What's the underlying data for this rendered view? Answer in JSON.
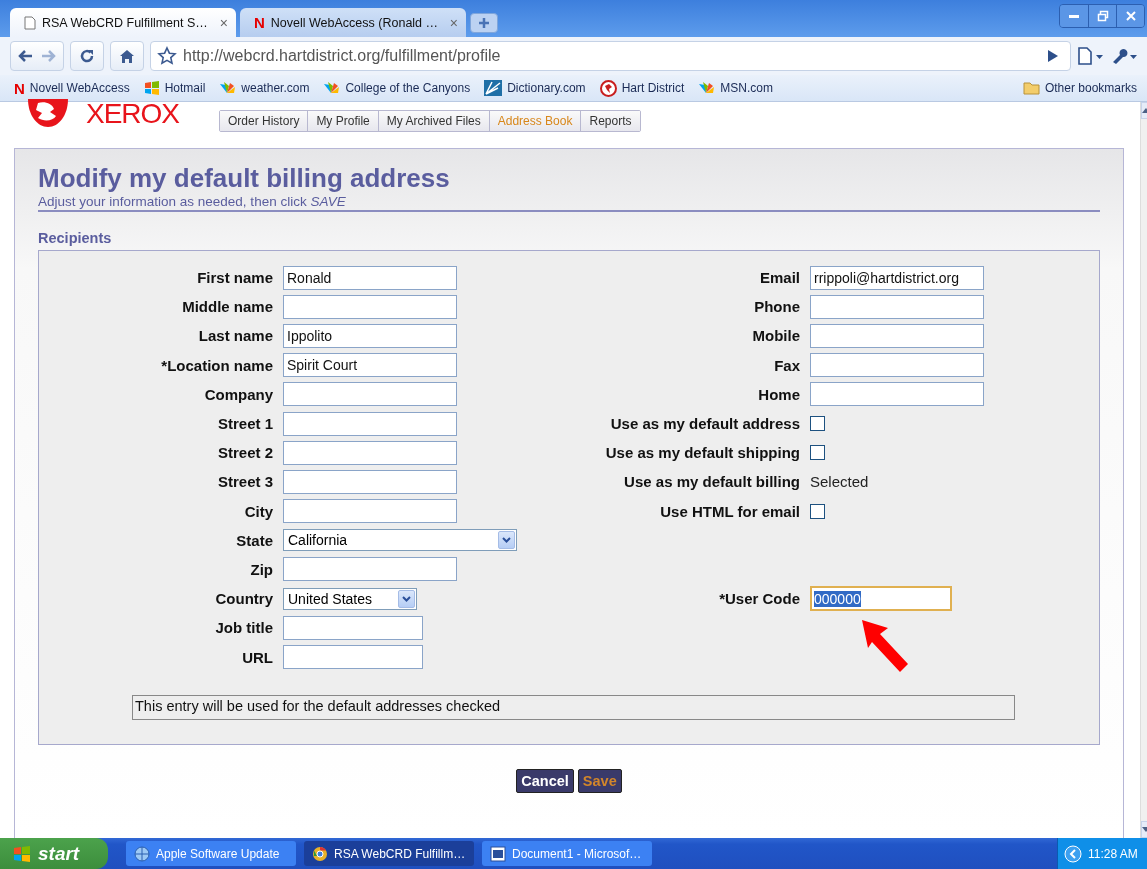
{
  "browser": {
    "tabs": [
      {
        "title": "RSA WebCRD Fulfillment S…",
        "kind": "page",
        "close_mark": "×",
        "selected": true
      },
      {
        "title": "Novell WebAccess (Ronald …",
        "kind": "novell",
        "logo_text": "N",
        "close_mark": "×",
        "selected": false
      }
    ],
    "url": "http://webcrd.hartdistrict.org/fulfillment/profile",
    "bookmarks": [
      {
        "label": "Novell WebAccess",
        "kind": "novell",
        "logo_text": "N"
      },
      {
        "label": "Hotmail",
        "kind": "windows"
      },
      {
        "label": "weather.com",
        "kind": "msn"
      },
      {
        "label": "College of the Canyons",
        "kind": "msn"
      },
      {
        "label": "Dictionary.com",
        "kind": "dictionary"
      },
      {
        "label": "Hart District",
        "kind": "hart"
      },
      {
        "label": "MSN.com",
        "kind": "msn"
      }
    ],
    "other_bookmarks": "Other bookmarks"
  },
  "site": {
    "logo": "XEROX",
    "nav": [
      {
        "label": "Order History",
        "selected": false
      },
      {
        "label": "My Profile",
        "selected": false
      },
      {
        "label": "My Archived Files",
        "selected": false
      },
      {
        "label": "Address Book",
        "selected": true
      },
      {
        "label": "Reports",
        "selected": false
      }
    ]
  },
  "heading": "Modify my default billing address",
  "subheading": "Adjust your information as needed, then click *SAVE*",
  "section": "Recipients",
  "left_fields": [
    {
      "label": "First name",
      "kind": "text",
      "value": "Ronald"
    },
    {
      "label": "Middle name",
      "kind": "text"
    },
    {
      "label": "Last name",
      "kind": "text",
      "value": "Ippolito"
    },
    {
      "label": "*Location name",
      "kind": "text",
      "value": "Spirit Court"
    },
    {
      "label": "Company",
      "kind": "text"
    },
    {
      "label": "Street 1",
      "kind": "text"
    },
    {
      "label": "Street 2",
      "kind": "text"
    },
    {
      "label": "Street 3",
      "kind": "text"
    },
    {
      "label": "City",
      "kind": "text"
    },
    {
      "label": "State",
      "kind": "select",
      "value": "California"
    },
    {
      "label": "Zip",
      "kind": "text"
    },
    {
      "label": "Country",
      "kind": "select",
      "value": "United States"
    },
    {
      "label": "Job title",
      "kind": "short"
    },
    {
      "label": "URL",
      "kind": "short"
    }
  ],
  "right_fields": [
    {
      "label": "Email",
      "kind": "text",
      "value": "rrippoli@hartdistrict.org"
    },
    {
      "label": "Phone",
      "kind": "text"
    },
    {
      "label": "Mobile",
      "kind": "text"
    },
    {
      "label": "Fax",
      "kind": "text"
    },
    {
      "label": "Home",
      "kind": "text"
    },
    {
      "label": "Use as my default address",
      "kind": "checkbox",
      "checked": false
    },
    {
      "label": "Use as my default shipping",
      "kind": "checkbox",
      "checked": false
    },
    {
      "label": "Use as my default billing",
      "kind": "static",
      "value": "Selected"
    },
    {
      "label": "Use HTML for email",
      "kind": "checkbox",
      "checked": false
    }
  ],
  "user_code": {
    "label": "*User Code",
    "value": "000000",
    "focused": true,
    "text_selected": true
  },
  "note": "This entry will be used for the default addresses checked",
  "buttons": [
    {
      "label": "Cancel",
      "kind": "cancel"
    },
    {
      "label": "Save",
      "kind": "save"
    }
  ],
  "taskbar": {
    "start": "start",
    "items": [
      {
        "label": "Apple Software Update",
        "kind": "update",
        "selected": false
      },
      {
        "label": "RSA WebCRD Fulfillm…",
        "kind": "chrome",
        "selected": true
      },
      {
        "label": "Document1 - Microsof…",
        "kind": "word",
        "selected": false
      }
    ],
    "clock": "11:28 AM"
  }
}
